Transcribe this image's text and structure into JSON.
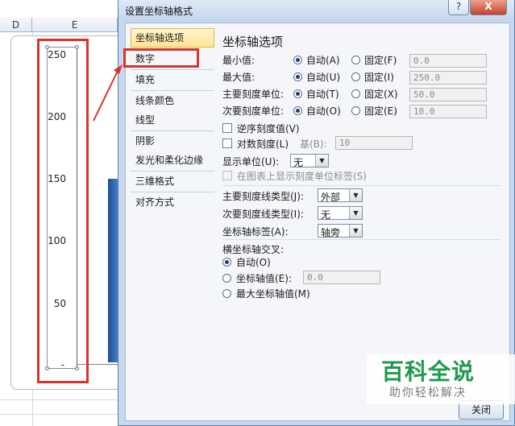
{
  "sheet": {
    "columns": [
      "D",
      "E"
    ],
    "axis_ticks": [
      "250",
      "200",
      "150",
      "100",
      "50",
      "-"
    ]
  },
  "dialog": {
    "title": "设置坐标轴格式",
    "help_label": "?",
    "close_label": "X",
    "ok_label": "关闭"
  },
  "nav": {
    "items": [
      {
        "label": "坐标轴选项",
        "selected": true
      },
      {
        "label": "数字"
      },
      {
        "label": "填充"
      },
      {
        "label": "线条颜色"
      },
      {
        "label": "线型"
      },
      {
        "label": "阴影"
      },
      {
        "label": "发光和柔化边缘"
      },
      {
        "label": "三维格式"
      },
      {
        "label": "对齐方式"
      }
    ]
  },
  "axis_options": {
    "title": "坐标轴选项",
    "auto_label": "自动",
    "fixed_label": "固定",
    "rows": [
      {
        "label": "最小值:",
        "auto_key": "A",
        "fixed_key": "F",
        "value": "0.0"
      },
      {
        "label": "最大值:",
        "auto_key": "U",
        "fixed_key": "I",
        "value": "250.0"
      },
      {
        "label": "主要刻度单位:",
        "auto_key": "T",
        "fixed_key": "X",
        "value": "50.0"
      },
      {
        "label": "次要刻度单位:",
        "auto_key": "O",
        "fixed_key": "E",
        "value": "10.0"
      }
    ],
    "auto_texts": [
      "自动(A)",
      "自动(U)",
      "自动(T)",
      "自动(O)"
    ],
    "fixed_texts": [
      "固定(F)",
      "固定(I)",
      "固定(X)",
      "固定(E)"
    ],
    "reverse_label": "逆序刻度值(V)",
    "log_label": "对数刻度(L)",
    "base_label": "基(B):",
    "base_value": "10",
    "display_units_label": "显示单位(U):",
    "display_units_value": "无",
    "show_units_label": "在图表上显示刻度单位标签(S)",
    "major_tick_label": "主要刻度线类型(J):",
    "major_tick_value": "外部",
    "minor_tick_label": "次要刻度线类型(I):",
    "minor_tick_value": "无",
    "axis_labels_label": "坐标轴标签(A):",
    "axis_labels_value": "轴旁",
    "cross_title": "横坐标轴交叉:",
    "cross_auto": "自动(O)",
    "cross_value_label": "坐标轴值(E):",
    "cross_value": "0.0",
    "cross_max": "最大坐标轴值(M)"
  },
  "watermark": {
    "title": "百科全说",
    "subtitle": "助你轻松解决"
  },
  "colors": {
    "highlight_red": "#d9342b",
    "selected_nav": "#ffe48f",
    "close_red": "#c7412a"
  }
}
